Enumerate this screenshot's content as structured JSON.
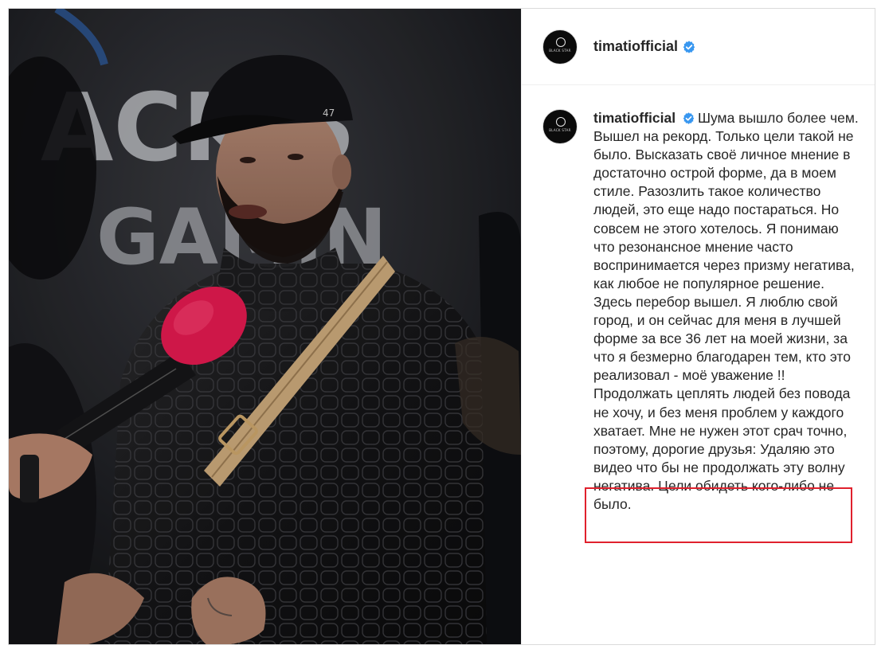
{
  "post": {
    "username": "timatiofficial",
    "avatar_text": "BLACK STAR",
    "caption": "Шума вышло более чем. Вышел на рекорд. Только цели такой не было. Высказать своё личное мнение в достаточно острой форме, да в моем стиле. Разозлить такое количество людей, это еще надо постараться. Но совсем не этого хотелось. Я понимаю что резонансное мнение часто воспринимается через призму негатива, как любое не популярное решение. Здесь перебор вышел. Я люблю свой город, и он сейчас для меня в лучшей форме за все 36 лет на моей жизни, за что я безмерно благодарен тем, кто это реализовал - моё уважение !! Продолжать цеплять людей без повода не хочу, и без меня проблем у каждого хватает. Мне не нужен этот срач точно, поэтому, дорогие друзья: Удаляю это видео что бы не продолжать эту волну негатива. Цели обидеть кого-либо не было."
  },
  "photo": {
    "backdrop_text_top": "ACK S",
    "backdrop_text_mid": "GAMIN",
    "cap_logo": "47"
  },
  "colors": {
    "verified_badge": "#3897f0",
    "highlight_box": "#e0212d",
    "microphone": "#e01a4f"
  }
}
